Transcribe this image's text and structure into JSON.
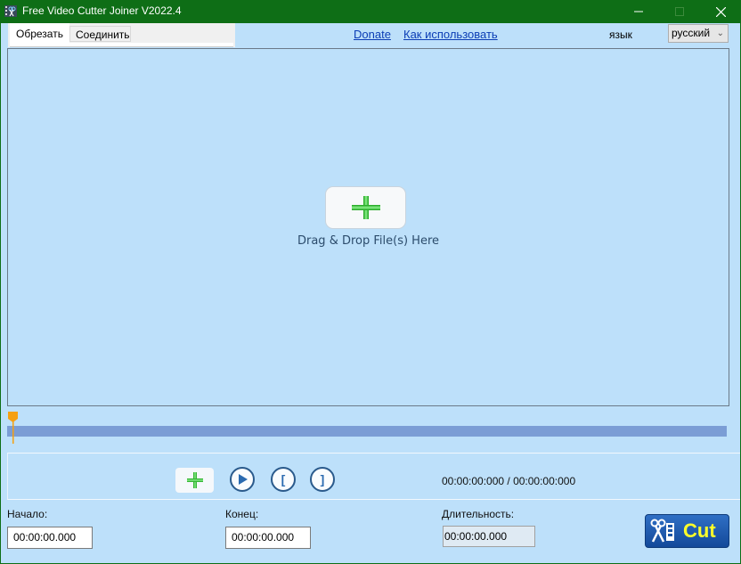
{
  "window": {
    "title": "Free Video Cutter Joiner V2022.4",
    "controls": {
      "minimize": "minimize-icon",
      "maximize": "maximize-icon",
      "close": "close-icon"
    }
  },
  "tabs": [
    {
      "label": "Обрезать",
      "active": true
    },
    {
      "label": "Соединить",
      "active": false
    }
  ],
  "links": {
    "donate": "Donate",
    "howto": "Как использовать"
  },
  "language": {
    "label": "язык",
    "selected": "русский"
  },
  "dropzone": {
    "text": "Drag & Drop File(s) Here",
    "icon": "plus-icon"
  },
  "seek": {
    "position_fraction": 0
  },
  "controls": {
    "add": "plus-icon",
    "play": "play-icon",
    "mark_start": "[",
    "mark_end": "]",
    "time_readout": "00:00:00:000 / 00:00:00:000"
  },
  "fields": {
    "start": {
      "label": "Начало:",
      "value": "00:00:00.000"
    },
    "end": {
      "label": "Конец:",
      "value": "00:00:00.000"
    },
    "duration": {
      "label": "Длительность:",
      "value": "00:00:00.000"
    }
  },
  "cut_button": {
    "label": "Cut",
    "icon": "scissors-film-icon"
  },
  "colors": {
    "titlebar": "#0e6e16",
    "client_bg": "#bde0fa",
    "seek_track": "#7b9dd5",
    "seek_handle": "#f5a012",
    "cut_label": "#ffff2a",
    "link": "#0b3db5"
  }
}
